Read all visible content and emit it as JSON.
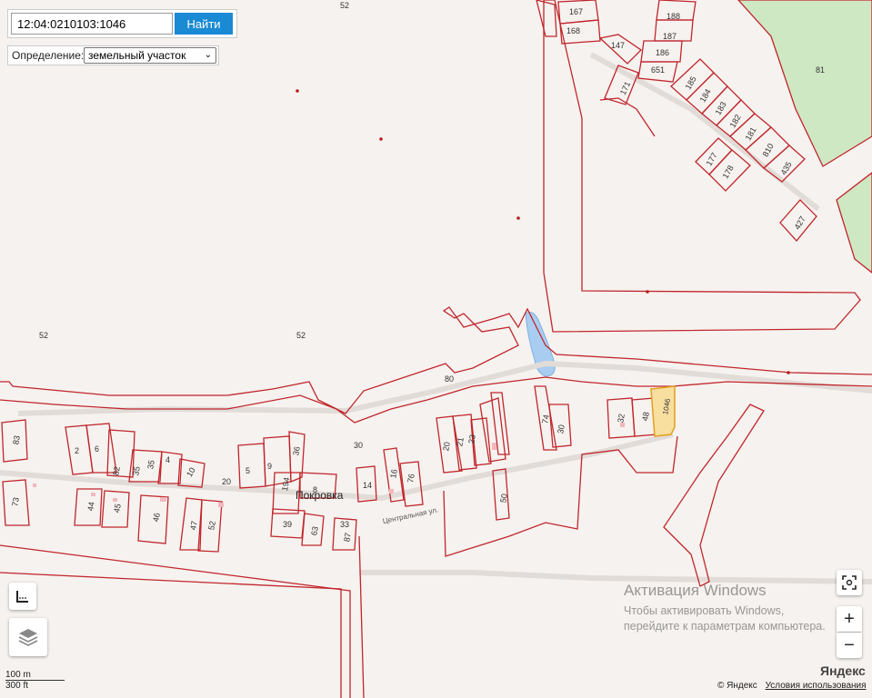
{
  "search": {
    "value": "12:04:0210103:1046",
    "button": "Найти"
  },
  "definition": {
    "label": "Определение:",
    "selected": "земельный участок"
  },
  "map": {
    "parcel_labels": [
      "167",
      "168",
      "188",
      "187",
      "186",
      "651",
      "147",
      "171",
      "185",
      "184",
      "183",
      "182",
      "181",
      "810",
      "435",
      "81",
      "177",
      "178",
      "427",
      "52",
      "52",
      "52",
      "80",
      "30",
      "83",
      "2",
      "6",
      "82",
      "35",
      "35",
      "4",
      "10",
      "20",
      "5",
      "9",
      "36",
      "194",
      "8",
      "14",
      "16",
      "76",
      "20",
      "21",
      "23",
      "74",
      "30",
      "32",
      "48",
      "1046",
      "50",
      "73",
      "44",
      "45",
      "46",
      "47",
      "52",
      "39",
      "63",
      "33",
      "87"
    ],
    "place_name": "Покровка",
    "street_name": "Центральная ул."
  },
  "scale": {
    "metric": "100 m",
    "imperial": "300 ft"
  },
  "watermark": {
    "title": "Активация Windows",
    "line1": "Чтобы активировать Windows,",
    "line2": "перейдите к параметрам компьютера."
  },
  "attribution": {
    "copyright": "© Яндекс",
    "terms": "Условия использования",
    "logo": "Яндекс"
  },
  "controls": {
    "zoom_in": "+",
    "zoom_out": "−"
  }
}
